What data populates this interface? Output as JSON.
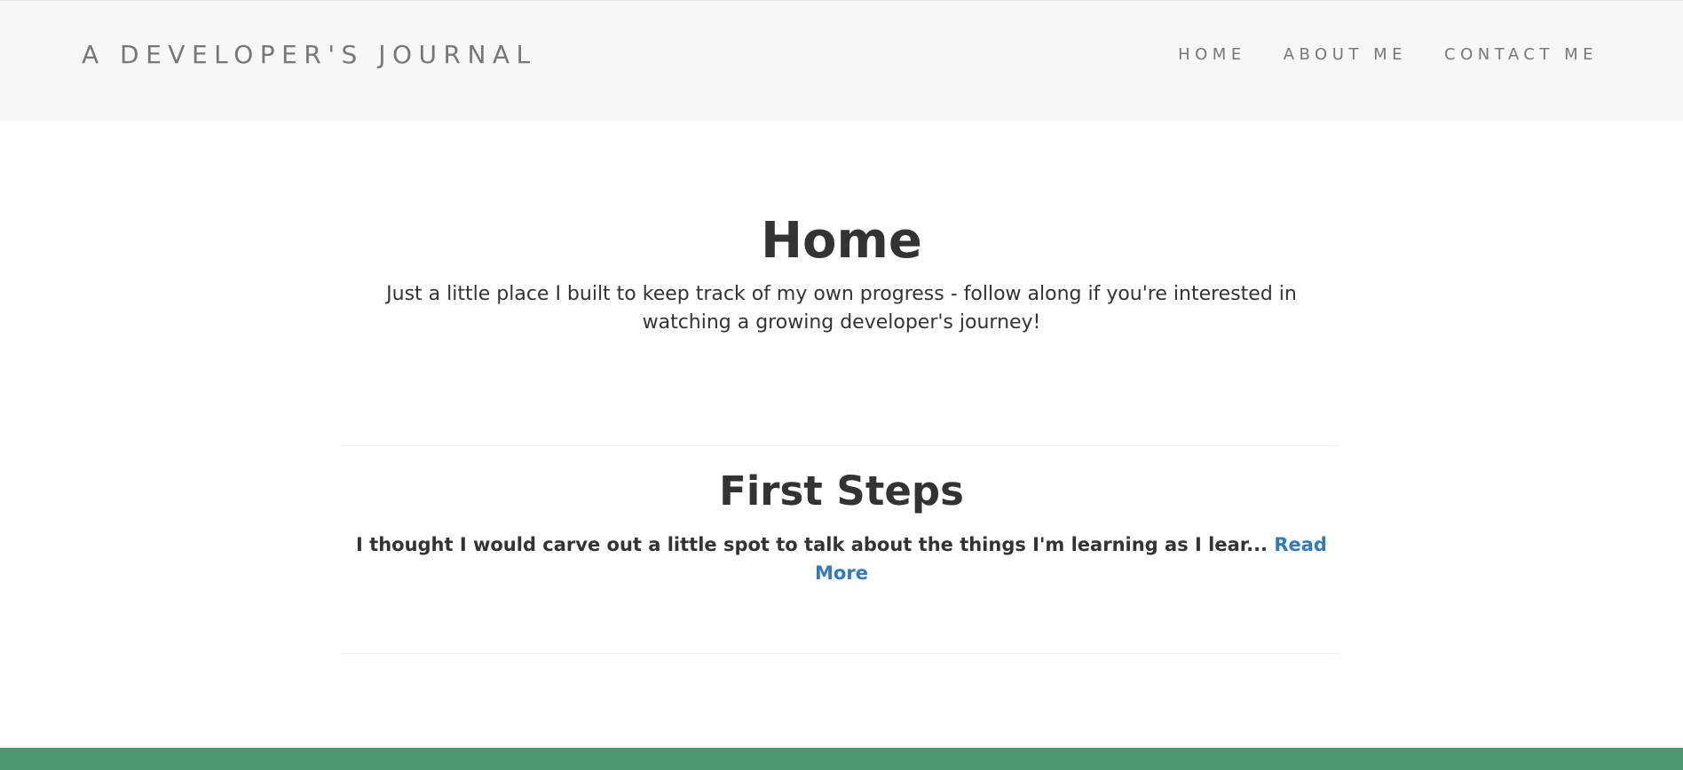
{
  "header": {
    "brand": "A DEVELOPER'S JOURNAL",
    "nav": [
      {
        "label": "HOME"
      },
      {
        "label": "ABOUT ME"
      },
      {
        "label": "CONTACT ME"
      }
    ]
  },
  "main": {
    "title": "Home",
    "tagline": "Just a little place I built to keep track of my own progress - follow along if you're interested in watching a growing developer's journey!"
  },
  "posts": [
    {
      "title": "First Steps",
      "excerpt": "I thought I would carve out a little spot to talk about the things I'm learning as I lear... ",
      "read_more": "Read More"
    }
  ],
  "colors": {
    "navbar_bg": "#f7f7f7",
    "link": "#337ab7",
    "footer": "#4e9670"
  }
}
